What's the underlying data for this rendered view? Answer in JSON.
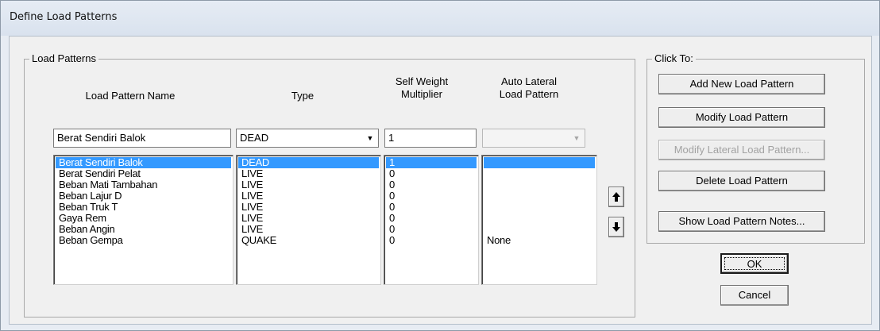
{
  "window": {
    "title": "Define Load Patterns"
  },
  "load_patterns": {
    "group_label": "Load Patterns",
    "headers": {
      "name": "Load Pattern Name",
      "type": "Type",
      "self_weight": "Self Weight\nMultiplier",
      "auto_lateral": "Auto Lateral\nLoad Pattern"
    },
    "inputs": {
      "name": "Berat Sendiri Balok",
      "type": "DEAD",
      "self_weight": "1",
      "auto_lateral": ""
    },
    "rows": [
      {
        "name": "Berat Sendiri Balok",
        "type": "DEAD",
        "self_weight": "1",
        "auto_lateral": ""
      },
      {
        "name": "Berat Sendiri Pelat",
        "type": "LIVE",
        "self_weight": "0",
        "auto_lateral": ""
      },
      {
        "name": "Beban Mati Tambahan",
        "type": "LIVE",
        "self_weight": "0",
        "auto_lateral": ""
      },
      {
        "name": "Beban Lajur D",
        "type": "LIVE",
        "self_weight": "0",
        "auto_lateral": ""
      },
      {
        "name": "Beban Truk T",
        "type": "LIVE",
        "self_weight": "0",
        "auto_lateral": ""
      },
      {
        "name": "Gaya Rem",
        "type": "LIVE",
        "self_weight": "0",
        "auto_lateral": ""
      },
      {
        "name": "Beban Angin",
        "type": "LIVE",
        "self_weight": "0",
        "auto_lateral": ""
      },
      {
        "name": "Beban Gempa",
        "type": "QUAKE",
        "self_weight": "0",
        "auto_lateral": "None"
      }
    ],
    "selected_index": 0
  },
  "click_to": {
    "group_label": "Click To:",
    "buttons": {
      "add": "Add New Load Pattern",
      "modify": "Modify Load Pattern",
      "modify_lateral": "Modify Lateral Load Pattern...",
      "delete": "Delete Load Pattern",
      "notes": "Show Load Pattern Notes..."
    }
  },
  "dialog_buttons": {
    "ok": "OK",
    "cancel": "Cancel"
  },
  "icons": {
    "move_up": "arrow-up-icon",
    "move_down": "arrow-down-icon",
    "dropdown": "chevron-down-icon"
  },
  "colors": {
    "selection": "#3399ff",
    "window_bg": "#f0f0f0",
    "title_bg": "#dde5ef"
  }
}
